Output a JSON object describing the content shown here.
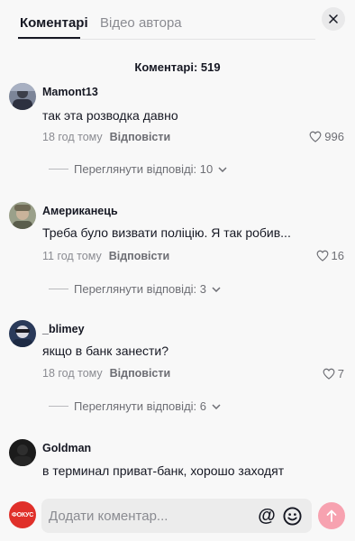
{
  "tabs": {
    "comments": "Коментарі",
    "author_videos": "Відео автора"
  },
  "comment_count": "Коментарі: 519",
  "comments": [
    {
      "username": "Mamont13",
      "text": "так эта розводка давно",
      "time": "18 год тому",
      "reply": "Відповісти",
      "likes": "996",
      "view_replies": "Переглянути відповіді: 10"
    },
    {
      "username": "Американець",
      "text": "Треба було визвати поліцію. Я так робив...",
      "time": "11 год тому",
      "reply": "Відповісти",
      "likes": "16",
      "view_replies": "Переглянути відповіді: 3"
    },
    {
      "username": "_blimey",
      "text": "якщо в банк занести?",
      "time": "18 год тому",
      "reply": "Відповісти",
      "likes": "7",
      "view_replies": "Переглянути відповіді: 6"
    },
    {
      "username": "Goldman",
      "text": "в терминал приват-банк, хорошо заходят"
    }
  ],
  "input": {
    "placeholder": "Додати коментар...",
    "avatar_label": "ФОКУС"
  },
  "icons": {
    "close": "close-icon",
    "heart": "heart-icon",
    "chevron": "chevron-down-icon",
    "at": "at-icon",
    "emoji": "emoji-icon",
    "send": "arrow-up-icon"
  },
  "colors": {
    "accent_send": "#f7a2b0",
    "avatar_brand": "#e0302a",
    "text_primary": "#161823",
    "text_secondary": "#8a8b91"
  }
}
